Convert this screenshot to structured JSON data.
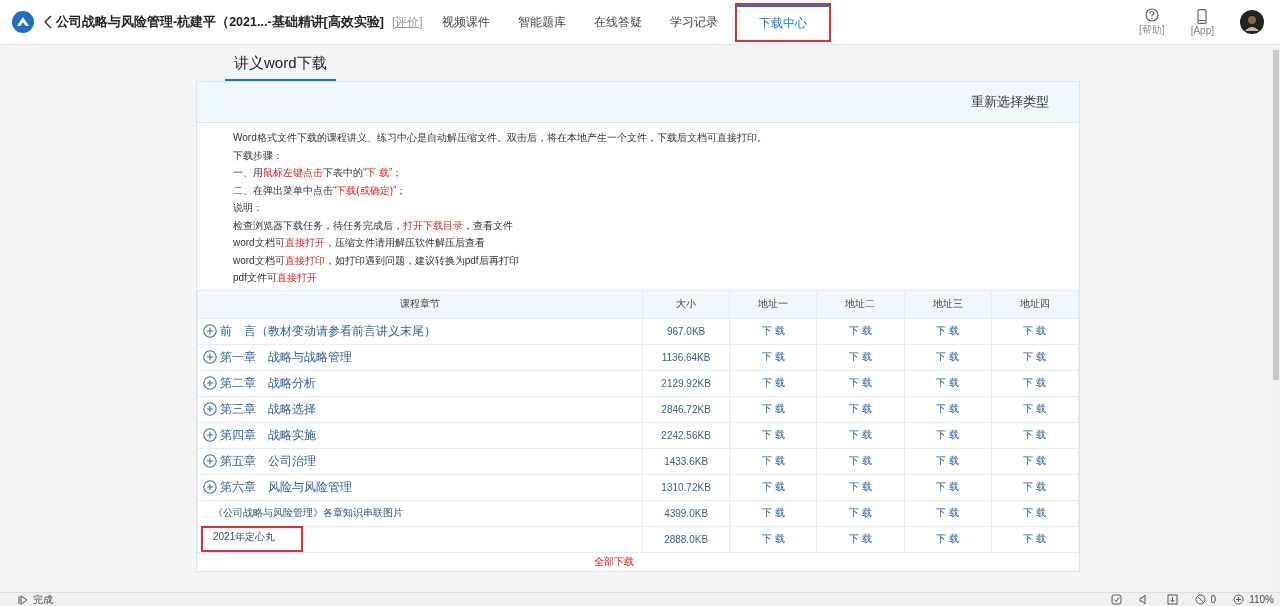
{
  "nav": {
    "course_title": "公司战略与风险管理-杭建平（2021...-基础精讲[高效实验]",
    "evaluate": "[评价]",
    "tabs": [
      {
        "label": "视频课件",
        "selected": false,
        "highlighted": false
      },
      {
        "label": "智能题库",
        "selected": false,
        "highlighted": false
      },
      {
        "label": "在线答疑",
        "selected": false,
        "highlighted": false
      },
      {
        "label": "学习记录",
        "selected": false,
        "highlighted": false
      },
      {
        "label": "下载中心",
        "selected": true,
        "highlighted": true
      }
    ],
    "actions": [
      {
        "kind": "help",
        "label": "[帮助]"
      },
      {
        "kind": "app",
        "label": "[App]"
      }
    ]
  },
  "section_tab": "讲义word下载",
  "reselect": "重新选择类型",
  "instructions": [
    [
      {
        "text": "Word格式文件下载的课程讲义、练习中心是自动解压缩文件。双击后，将在本地产生一个文件，下载后文档可直接打印。",
        "emphasis": false
      }
    ],
    [
      {
        "text": "下载步骤：",
        "emphasis": false
      }
    ],
    [
      {
        "text": "一、用",
        "emphasis": false
      },
      {
        "text": "鼠标左键点击",
        "emphasis": true
      },
      {
        "text": "下表中的",
        "emphasis": false
      },
      {
        "text": "“下 载”",
        "emphasis": true
      },
      {
        "text": "；",
        "emphasis": false
      }
    ],
    [
      {
        "text": "二、在弹出菜单中点击",
        "emphasis": false
      },
      {
        "text": "“下载(或确定)”",
        "emphasis": true
      },
      {
        "text": "；",
        "emphasis": false
      }
    ],
    [
      {
        "text": "说明：",
        "emphasis": false
      }
    ],
    [
      {
        "text": "检查浏览器下载任务，待任务完成后，",
        "emphasis": false
      },
      {
        "text": "打开下载目录",
        "emphasis": true
      },
      {
        "text": "，查看文件",
        "emphasis": false
      }
    ],
    [
      {
        "text": "word文档可",
        "emphasis": false
      },
      {
        "text": "直接打开",
        "emphasis": true
      },
      {
        "text": "，压缩文件请用解压软件解压后查看",
        "emphasis": false
      }
    ],
    [
      {
        "text": "word文档可",
        "emphasis": false
      },
      {
        "text": "直接打印",
        "emphasis": true
      },
      {
        "text": "，如打印遇到问题，建议转换为pdf后再打印",
        "emphasis": false
      }
    ],
    [
      {
        "text": "pdf文件可",
        "emphasis": false
      },
      {
        "text": "直接打开",
        "emphasis": true
      }
    ]
  ],
  "table": {
    "columns": [
      "课程章节",
      "大小",
      "地址一",
      "地址二",
      "地址三",
      "地址四"
    ],
    "rows": [
      {
        "kind": "chapter",
        "title": "前　言（教材变动请参看前言讲义末尾）",
        "size": "967.0KB",
        "links": [
          "下 载",
          "下 载",
          "下 载",
          "下 载"
        ],
        "highlighted": false
      },
      {
        "kind": "chapter",
        "title": "第一章　战略与战略管理",
        "size": "1136.64KB",
        "links": [
          "下 载",
          "下 载",
          "下 载",
          "下 载"
        ],
        "highlighted": false
      },
      {
        "kind": "chapter",
        "title": "第二章　战略分析",
        "size": "2129.92KB",
        "links": [
          "下 载",
          "下 载",
          "下 载",
          "下 载"
        ],
        "highlighted": false
      },
      {
        "kind": "chapter",
        "title": "第三章　战略选择",
        "size": "2846.72KB",
        "links": [
          "下 载",
          "下 载",
          "下 载",
          "下 载"
        ],
        "highlighted": false
      },
      {
        "kind": "chapter",
        "title": "第四章　战略实施",
        "size": "2242.56KB",
        "links": [
          "下 载",
          "下 载",
          "下 载",
          "下 载"
        ],
        "highlighted": false
      },
      {
        "kind": "chapter",
        "title": "第五章　公司治理",
        "size": "1433.6KB",
        "links": [
          "下 载",
          "下 载",
          "下 载",
          "下 载"
        ],
        "highlighted": false
      },
      {
        "kind": "chapter",
        "title": "第六章　风险与风险管理",
        "size": "1310.72KB",
        "links": [
          "下 载",
          "下 载",
          "下 载",
          "下 载"
        ],
        "highlighted": false
      },
      {
        "kind": "attachment",
        "title": "《公司战略与风险管理》各章知识串联图片",
        "size": "4399.0KB",
        "links": [
          "下 载",
          "下 载",
          "下 载",
          "下 载"
        ],
        "highlighted": false
      },
      {
        "kind": "attachment",
        "title": "2021年定心丸",
        "size": "2888.0KB",
        "links": [
          "下 载",
          "下 载",
          "下 载",
          "下 载"
        ],
        "highlighted": true
      }
    ]
  },
  "download_all": "全部下载",
  "status_bar": {
    "text": "完成",
    "count": "0",
    "zoom": "110%"
  }
}
